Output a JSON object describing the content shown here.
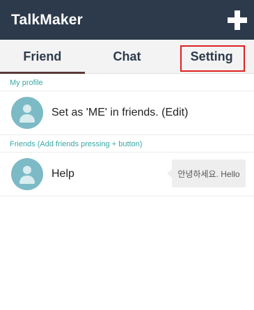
{
  "app": {
    "title": "TalkMaker",
    "add_icon": "plus-icon"
  },
  "tabs": [
    {
      "label": "Friend",
      "active": true
    },
    {
      "label": "Chat",
      "active": false
    },
    {
      "label": "Setting",
      "active": false,
      "highlighted": true
    }
  ],
  "profile_section": {
    "header": "My profile",
    "item": {
      "label": "Set as 'ME' in friends. (Edit)",
      "avatar_icon": "person-icon"
    }
  },
  "friends_section": {
    "header": "Friends (Add friends pressing + button)",
    "items": [
      {
        "name": "Help",
        "last_message": "안녕하세요. Hello",
        "avatar_icon": "person-icon"
      }
    ]
  },
  "colors": {
    "appbar": "#2d3a4b",
    "accent_teal": "#3aa8a8",
    "avatar": "#7cbac6",
    "highlight_box": "#e02020"
  }
}
